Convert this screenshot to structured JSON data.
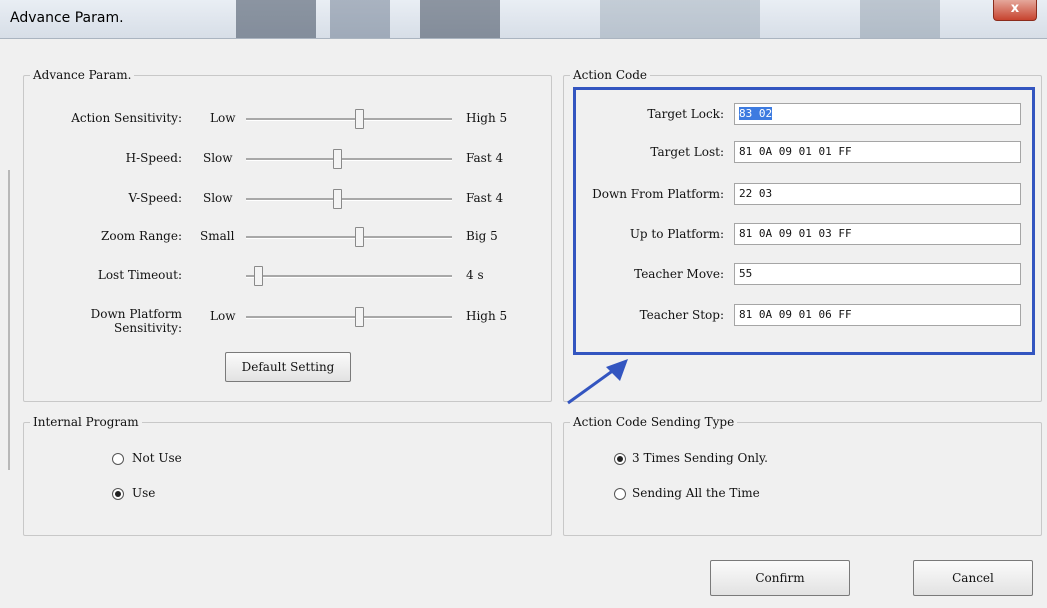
{
  "window": {
    "title": "Advance Param.",
    "close_label": "x"
  },
  "advance_param": {
    "title": "Advance Param.",
    "sliders": [
      {
        "label": "Action Sensitivity:",
        "min": "Low",
        "max": "High 5",
        "level": 0.55
      },
      {
        "label": "H-Speed:",
        "min": "Slow",
        "max": "Fast 4",
        "level": 0.44
      },
      {
        "label": "V-Speed:",
        "min": "Slow",
        "max": "Fast 4",
        "level": 0.44
      },
      {
        "label": "Zoom Range:",
        "min": "Small",
        "max": "Big 5",
        "level": 0.55
      },
      {
        "label": "Lost Timeout:",
        "min": "",
        "max": "4 s",
        "level": 0.06
      },
      {
        "label": "Down Platform Sensitivity:",
        "label_line1": "Down Platform",
        "label_line2": "Sensitivity:",
        "min": "Low",
        "max": "High 5",
        "level": 0.55
      }
    ],
    "default_button": "Default Setting"
  },
  "action_code": {
    "title": "Action Code",
    "fields": [
      {
        "label": "Target Lock:",
        "value": "83 02",
        "selected": true
      },
      {
        "label": "Target Lost:",
        "value": "81 0A 09 01 01 FF"
      },
      {
        "label": "Down From Platform:",
        "value": "22 03"
      },
      {
        "label": "Up to Platform:",
        "value": "81 0A 09 01 03 FF"
      },
      {
        "label": "Teacher Move:",
        "value": "55"
      },
      {
        "label": "Teacher Stop:",
        "value": "81 0A 09 01 06 FF"
      }
    ]
  },
  "internal_program": {
    "title": "Internal Program",
    "options": [
      {
        "label": "Not Use",
        "checked": false
      },
      {
        "label": "Use",
        "checked": true
      }
    ]
  },
  "sending_type": {
    "title": "Action Code Sending Type",
    "options": [
      {
        "label": "3 Times Sending Only.",
        "checked": true
      },
      {
        "label": "Sending All the Time",
        "checked": false
      }
    ]
  },
  "footer": {
    "confirm": "Confirm",
    "cancel": "Cancel"
  },
  "colors": {
    "highlight_border": "#3355c0",
    "selection": "#3d7be0"
  }
}
